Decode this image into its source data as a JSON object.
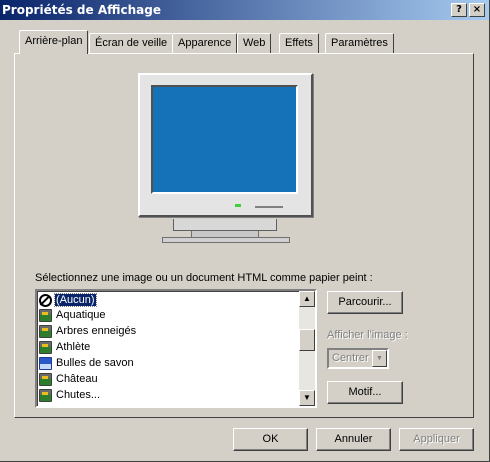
{
  "window": {
    "title": "Propriétés de Affichage",
    "help_label": "?",
    "close_label": "×"
  },
  "tabs": [
    {
      "label": "Arrière-plan",
      "active": true
    },
    {
      "label": "Écran de veille"
    },
    {
      "label": "Apparence"
    },
    {
      "label": "Web"
    },
    {
      "label": "Effets"
    },
    {
      "label": "Paramètres"
    }
  ],
  "monitor": {
    "screen_color": "#1672b8"
  },
  "wallpaper": {
    "label": "Sélectionnez une image ou un document HTML comme papier peint :",
    "items": [
      {
        "label": "(Aucun)",
        "icon": "none-icon",
        "selected": true
      },
      {
        "label": "Aquatique",
        "icon": "jpg-file-icon"
      },
      {
        "label": "Arbres enneigés",
        "icon": "jpg-file-icon"
      },
      {
        "label": "Athlète",
        "icon": "jpg-file-icon"
      },
      {
        "label": "Bulles de savon",
        "icon": "bmp-file-icon"
      },
      {
        "label": "Château",
        "icon": "jpg-file-icon"
      },
      {
        "label": "Chutes...",
        "icon": "jpg-file-icon"
      }
    ]
  },
  "side": {
    "browse_label": "Parcourir...",
    "display_label": "Afficher l'image :",
    "display_value": "Centrer",
    "pattern_label": "Motif..."
  },
  "footer": {
    "ok_label": "OK",
    "cancel_label": "Annuler",
    "apply_label": "Appliquer"
  }
}
